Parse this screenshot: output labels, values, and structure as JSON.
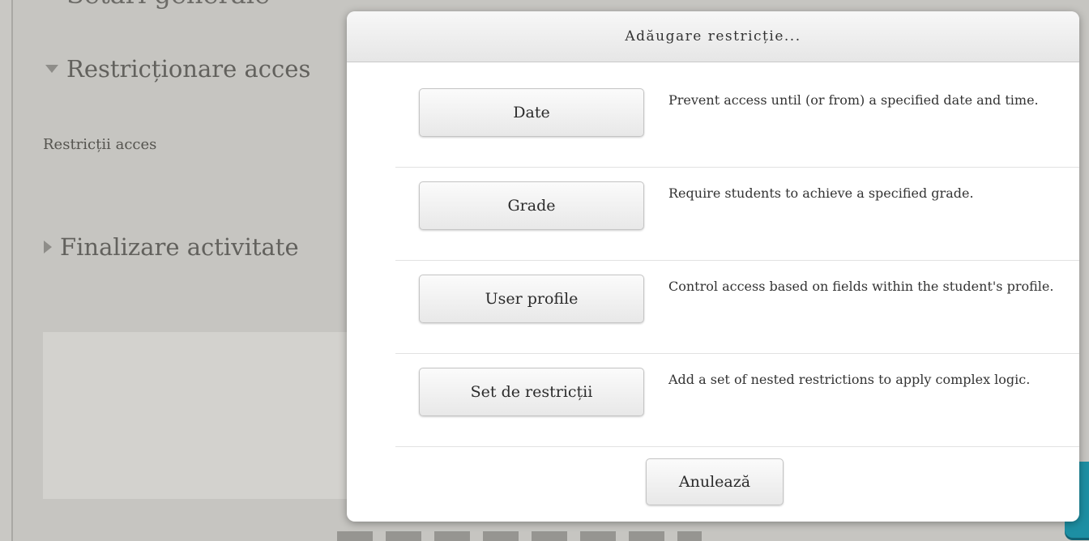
{
  "background": {
    "top_cut_text": "Setări generale",
    "sections": [
      {
        "label": "Restricționare acces",
        "state": "expanded"
      },
      {
        "label": "Finalizare activitate",
        "state": "collapsed"
      }
    ],
    "restrictions_label": "Restricții acces",
    "accent_tab_color": "#1d8fa3"
  },
  "dialog": {
    "title": "Adăugare restricție...",
    "options": [
      {
        "button": "Date",
        "description": "Prevent access until (or from) a specified date and time."
      },
      {
        "button": "Grade",
        "description": "Require students to achieve a specified grade."
      },
      {
        "button": "User profile",
        "description": "Control access based on fields within the student's profile."
      },
      {
        "button": "Set de restricții",
        "description": "Add a set of nested restrictions to apply complex logic."
      }
    ],
    "cancel_label": "Anulează"
  }
}
